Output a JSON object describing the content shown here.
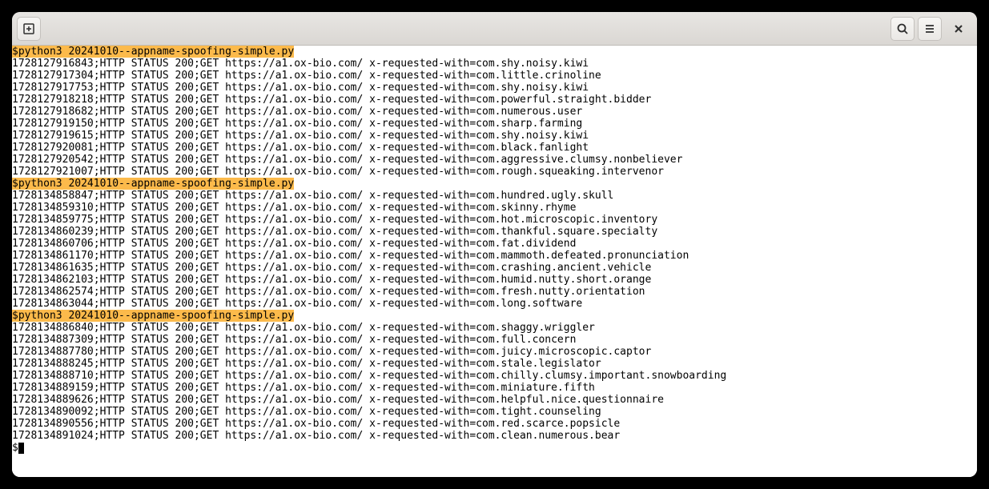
{
  "titlebar": {
    "newtab_icon": "new-tab-icon",
    "search_icon": "search-icon",
    "menu_icon": "hamburger-icon",
    "close_icon": "close-icon"
  },
  "terminal": {
    "prompt": "$",
    "runs": [
      {
        "command": "$python3 20241010--appname-spoofing-simple.py",
        "lines": [
          "1728127916843;HTTP STATUS 200;GET https://a1.ox-bio.com/ x-requested-with=com.shy.noisy.kiwi",
          "1728127917304;HTTP STATUS 200;GET https://a1.ox-bio.com/ x-requested-with=com.little.crinoline",
          "1728127917753;HTTP STATUS 200;GET https://a1.ox-bio.com/ x-requested-with=com.shy.noisy.kiwi",
          "1728127918218;HTTP STATUS 200;GET https://a1.ox-bio.com/ x-requested-with=com.powerful.straight.bidder",
          "1728127918682;HTTP STATUS 200;GET https://a1.ox-bio.com/ x-requested-with=com.numerous.user",
          "1728127919150;HTTP STATUS 200;GET https://a1.ox-bio.com/ x-requested-with=com.sharp.farming",
          "1728127919615;HTTP STATUS 200;GET https://a1.ox-bio.com/ x-requested-with=com.shy.noisy.kiwi",
          "1728127920081;HTTP STATUS 200;GET https://a1.ox-bio.com/ x-requested-with=com.black.fanlight",
          "1728127920542;HTTP STATUS 200;GET https://a1.ox-bio.com/ x-requested-with=com.aggressive.clumsy.nonbeliever",
          "1728127921007;HTTP STATUS 200;GET https://a1.ox-bio.com/ x-requested-with=com.rough.squeaking.intervenor"
        ]
      },
      {
        "command": "$python3 20241010--appname-spoofing-simple.py",
        "lines": [
          "1728134858847;HTTP STATUS 200;GET https://a1.ox-bio.com/ x-requested-with=com.hundred.ugly.skull",
          "1728134859310;HTTP STATUS 200;GET https://a1.ox-bio.com/ x-requested-with=com.skinny.rhyme",
          "1728134859775;HTTP STATUS 200;GET https://a1.ox-bio.com/ x-requested-with=com.hot.microscopic.inventory",
          "1728134860239;HTTP STATUS 200;GET https://a1.ox-bio.com/ x-requested-with=com.thankful.square.specialty",
          "1728134860706;HTTP STATUS 200;GET https://a1.ox-bio.com/ x-requested-with=com.fat.dividend",
          "1728134861170;HTTP STATUS 200;GET https://a1.ox-bio.com/ x-requested-with=com.mammoth.defeated.pronunciation",
          "1728134861635;HTTP STATUS 200;GET https://a1.ox-bio.com/ x-requested-with=com.crashing.ancient.vehicle",
          "1728134862103;HTTP STATUS 200;GET https://a1.ox-bio.com/ x-requested-with=com.humid.nutty.short.orange",
          "1728134862574;HTTP STATUS 200;GET https://a1.ox-bio.com/ x-requested-with=com.fresh.nutty.orientation",
          "1728134863044;HTTP STATUS 200;GET https://a1.ox-bio.com/ x-requested-with=com.long.software"
        ]
      },
      {
        "command": "$python3 20241010--appname-spoofing-simple.py",
        "lines": [
          "1728134886840;HTTP STATUS 200;GET https://a1.ox-bio.com/ x-requested-with=com.shaggy.wriggler",
          "1728134887309;HTTP STATUS 200;GET https://a1.ox-bio.com/ x-requested-with=com.full.concern",
          "1728134887780;HTTP STATUS 200;GET https://a1.ox-bio.com/ x-requested-with=com.juicy.microscopic.captor",
          "1728134888245;HTTP STATUS 200;GET https://a1.ox-bio.com/ x-requested-with=com.stale.legislator",
          "1728134888710;HTTP STATUS 200;GET https://a1.ox-bio.com/ x-requested-with=com.chilly.clumsy.important.snowboarding",
          "1728134889159;HTTP STATUS 200;GET https://a1.ox-bio.com/ x-requested-with=com.miniature.fifth",
          "1728134889626;HTTP STATUS 200;GET https://a1.ox-bio.com/ x-requested-with=com.helpful.nice.questionnaire",
          "1728134890092;HTTP STATUS 200;GET https://a1.ox-bio.com/ x-requested-with=com.tight.counseling",
          "1728134890556;HTTP STATUS 200;GET https://a1.ox-bio.com/ x-requested-with=com.red.scarce.popsicle",
          "1728134891024;HTTP STATUS 200;GET https://a1.ox-bio.com/ x-requested-with=com.clean.numerous.bear"
        ]
      }
    ]
  }
}
